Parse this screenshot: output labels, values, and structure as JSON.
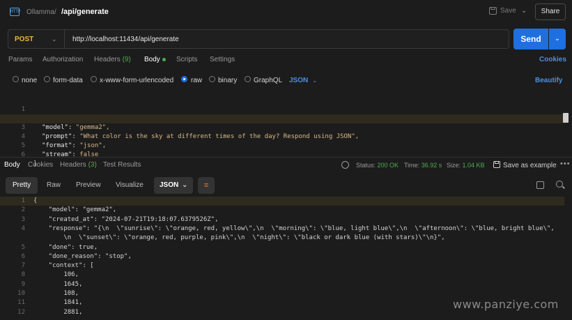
{
  "breadcrumb": {
    "parent": "Ollamma",
    "separator": "/",
    "current": "/api/generate"
  },
  "toolbar": {
    "save_label": "Save",
    "share_label": "Share"
  },
  "request": {
    "method": "POST",
    "url": "http://localhost:11434/api/generate",
    "send_label": "Send"
  },
  "request_tabs": {
    "params": "Params",
    "authorization": "Authorization",
    "headers": "Headers",
    "headers_count": "(9)",
    "body": "Body",
    "scripts": "Scripts",
    "settings": "Settings",
    "cookies": "Cookies"
  },
  "body_types": {
    "none": "none",
    "form_data": "form-data",
    "urlencoded": "x-www-form-urlencoded",
    "raw": "raw",
    "binary": "binary",
    "graphql": "GraphQL",
    "format": "JSON",
    "beautify": "Beautify",
    "selected": "raw"
  },
  "request_body": {
    "lines": [
      {
        "n": "1",
        "text": "{"
      },
      {
        "n": "2",
        "key": "\"model\"",
        "value": "\"gemma2\","
      },
      {
        "n": "3",
        "key": "\"prompt\"",
        "value": "\"What color is the sky at different times of the day? Respond using JSON\","
      },
      {
        "n": "4",
        "key": "\"format\"",
        "value": "\"json\","
      },
      {
        "n": "5",
        "key": "\"stream\"",
        "value": "false"
      },
      {
        "n": "6",
        "text": "}"
      }
    ]
  },
  "response_tabs": {
    "body": "Body",
    "cookies": "Cookies",
    "headers": "Headers",
    "headers_count": "(3)",
    "test_results": "Test Results"
  },
  "response_meta": {
    "status_label": "Status:",
    "status_value": "200 OK",
    "time_label": "Time:",
    "time_value": "36.92 s",
    "size_label": "Size:",
    "size_value": "1.04 KB",
    "save_example": "Save as example"
  },
  "response_view": {
    "pretty": "Pretty",
    "raw": "Raw",
    "preview": "Preview",
    "visualize": "Visualize",
    "format": "JSON"
  },
  "response_body": {
    "lines": [
      {
        "n": "1",
        "text": "{"
      },
      {
        "n": "2",
        "text": "    \"model\": \"gemma2\","
      },
      {
        "n": "3",
        "text": "    \"created_at\": \"2024-07-21T19:18:07.6379526Z\","
      },
      {
        "n": "4",
        "text": "    \"response\": \"{\\n  \\\"sunrise\\\": \\\"orange, red, yellow\\\",\\n  \\\"morning\\\": \\\"blue, light blue\\\",\\n  \\\"afternoon\\\": \\\"blue, bright blue\\\","
      },
      {
        "n": "",
        "text": "        \\n  \\\"sunset\\\": \\\"orange, red, purple, pink\\\",\\n  \\\"night\\\": \\\"black or dark blue (with stars)\\\"\\n}\","
      },
      {
        "n": "5",
        "text": "    \"done\": true,"
      },
      {
        "n": "6",
        "text": "    \"done_reason\": \"stop\","
      },
      {
        "n": "7",
        "text": "    \"context\": ["
      },
      {
        "n": "8",
        "text": "        106,"
      },
      {
        "n": "9",
        "text": "        1645,"
      },
      {
        "n": "10",
        "text": "        108,"
      },
      {
        "n": "11",
        "text": "        1841,"
      },
      {
        "n": "12",
        "text": "        2881,"
      }
    ]
  },
  "watermark": "www.panziye.com"
}
